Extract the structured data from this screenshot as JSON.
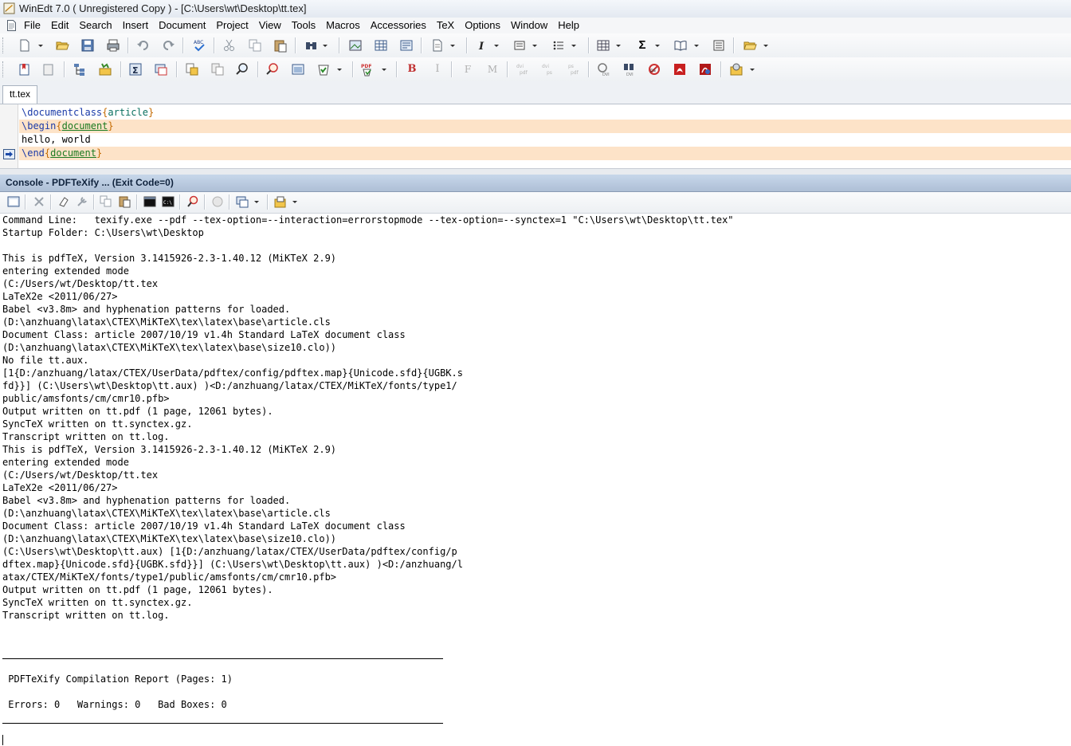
{
  "window": {
    "title": "WinEdt 7.0  ( Unregistered  Copy )  - [C:\\Users\\wt\\Desktop\\tt.tex]"
  },
  "menu": [
    "File",
    "Edit",
    "Search",
    "Insert",
    "Document",
    "Project",
    "View",
    "Tools",
    "Macros",
    "Accessories",
    "TeX",
    "Options",
    "Window",
    "Help"
  ],
  "toolbar": {
    "bold_label": "B",
    "italic_label": "I",
    "font_label": "F",
    "math_label": "M",
    "sigma_label": "Σ",
    "pdf_label": "PDF"
  },
  "tabs": [
    {
      "label": "tt.tex",
      "active": true
    }
  ],
  "editor": {
    "line1": {
      "cmd": "\\documentclass",
      "open": "{",
      "arg": "article",
      "close": "}"
    },
    "line2": {
      "cmd": "\\begin",
      "open": "{",
      "arg": "document",
      "close": "}"
    },
    "line3": {
      "text": "hello, world"
    },
    "line4": {
      "cmd": "\\end",
      "open": "{",
      "arg": "document",
      "close": "}"
    }
  },
  "console": {
    "title": "Console - PDFTeXify ... (Exit Code=0)",
    "log": "Command Line:   texify.exe --pdf --tex-option=--interaction=errorstopmode --tex-option=--synctex=1 \"C:\\Users\\wt\\Desktop\\tt.tex\"\nStartup Folder: C:\\Users\\wt\\Desktop\n\nThis is pdfTeX, Version 3.1415926-2.3-1.40.12 (MiKTeX 2.9)\nentering extended mode\n(C:/Users/wt/Desktop/tt.tex\nLaTeX2e <2011/06/27>\nBabel <v3.8m> and hyphenation patterns for loaded.\n(D:\\anzhuang\\latax\\CTEX\\MiKTeX\\tex\\latex\\base\\article.cls\nDocument Class: article 2007/10/19 v1.4h Standard LaTeX document class\n(D:\\anzhuang\\latax\\CTEX\\MiKTeX\\tex\\latex\\base\\size10.clo))\nNo file tt.aux.\n[1{D:/anzhuang/latax/CTEX/UserData/pdftex/config/pdftex.map}{Unicode.sfd}{UGBK.s\nfd}}] (C:\\Users\\wt\\Desktop\\tt.aux) )<D:/anzhuang/latax/CTEX/MiKTeX/fonts/type1/\npublic/amsfonts/cm/cmr10.pfb>\nOutput written on tt.pdf (1 page, 12061 bytes).\nSyncTeX written on tt.synctex.gz.\nTranscript written on tt.log.\nThis is pdfTeX, Version 3.1415926-2.3-1.40.12 (MiKTeX 2.9)\nentering extended mode\n(C:/Users/wt/Desktop/tt.tex\nLaTeX2e <2011/06/27>\nBabel <v3.8m> and hyphenation patterns for loaded.\n(D:\\anzhuang\\latax\\CTEX\\MiKTeX\\tex\\latex\\base\\article.cls\nDocument Class: article 2007/10/19 v1.4h Standard LaTeX document class\n(D:\\anzhuang\\latax\\CTEX\\MiKTeX\\tex\\latex\\base\\size10.clo))\n(C:\\Users\\wt\\Desktop\\tt.aux) [1{D:/anzhuang/latax/CTEX/UserData/pdftex/config/p\ndftex.map}{Unicode.sfd}{UGBK.sfd}}] (C:\\Users\\wt\\Desktop\\tt.aux) )<D:/anzhuang/l\natax/CTEX/MiKTeX/fonts/type1/public/amsfonts/cm/cmr10.pfb>\nOutput written on tt.pdf (1 page, 12061 bytes).\nSyncTeX written on tt.synctex.gz.\nTranscript written on tt.log.",
    "report_title": " PDFTeXify Compilation Report (Pages: 1)",
    "report_summary": " Errors: 0   Warnings: 0   Bad Boxes: 0"
  }
}
